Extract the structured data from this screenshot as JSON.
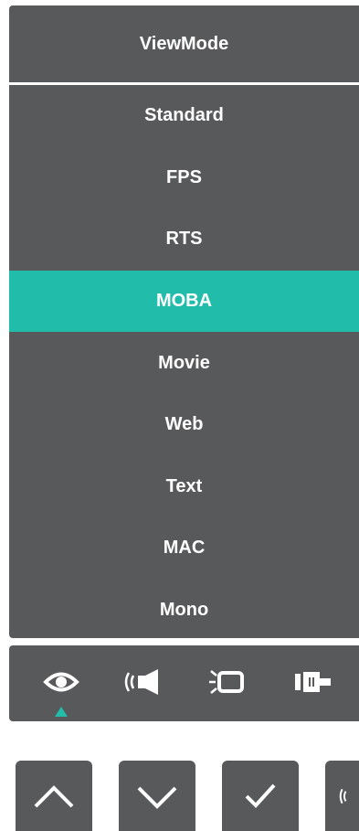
{
  "menu": {
    "title": "ViewMode",
    "items": [
      {
        "label": "Standard",
        "selected": false
      },
      {
        "label": "FPS",
        "selected": false
      },
      {
        "label": "RTS",
        "selected": false
      },
      {
        "label": "MOBA",
        "selected": true
      },
      {
        "label": "Movie",
        "selected": false
      },
      {
        "label": "Web",
        "selected": false
      },
      {
        "label": "Text",
        "selected": false
      },
      {
        "label": "MAC",
        "selected": false
      },
      {
        "label": "Mono",
        "selected": false
      }
    ]
  },
  "toolbar": {
    "icons": [
      "eye-icon",
      "sound-speaker-icon",
      "display-brightness-icon",
      "input-connector-icon"
    ],
    "active": "eye-icon"
  },
  "buttons": [
    "up-icon",
    "down-icon",
    "check-icon",
    "sound-icon"
  ],
  "colors": {
    "panel": "#58595b",
    "accent": "#22bcab",
    "text": "#ffffff"
  }
}
